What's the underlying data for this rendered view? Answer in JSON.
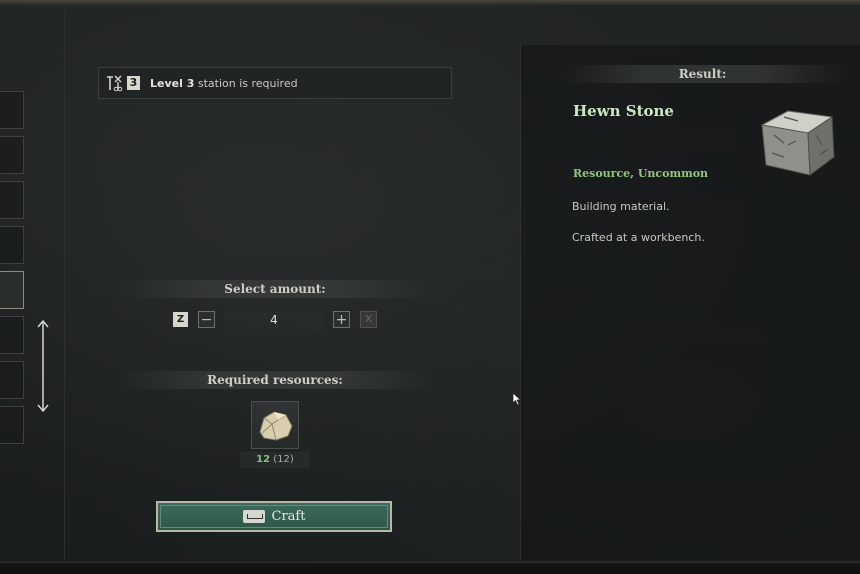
{
  "requirement": {
    "level_badge": "3",
    "level_text": "Level 3",
    "rest_text": " station is required"
  },
  "amount": {
    "header": "Select amount:",
    "hotkey": "Z",
    "minus": "−",
    "value": "4",
    "plus": "+",
    "max": "X"
  },
  "resources": {
    "header": "Required resources:",
    "items": [
      {
        "icon": "stone-chunk-icon",
        "have": "12",
        "need": "(12)"
      }
    ]
  },
  "craft": {
    "label": "Craft",
    "icon": "keyboard-icon"
  },
  "result": {
    "header": "Result:",
    "name": "Hewn Stone",
    "type": "Resource, Uncommon",
    "desc1": "Building material.",
    "desc2": "Crafted at a workbench.",
    "icon": "hewn-stone-icon"
  },
  "colors": {
    "accent_green": "#93c57e",
    "craft_button": "#3d6b5d",
    "title": "#cfe7c0"
  }
}
